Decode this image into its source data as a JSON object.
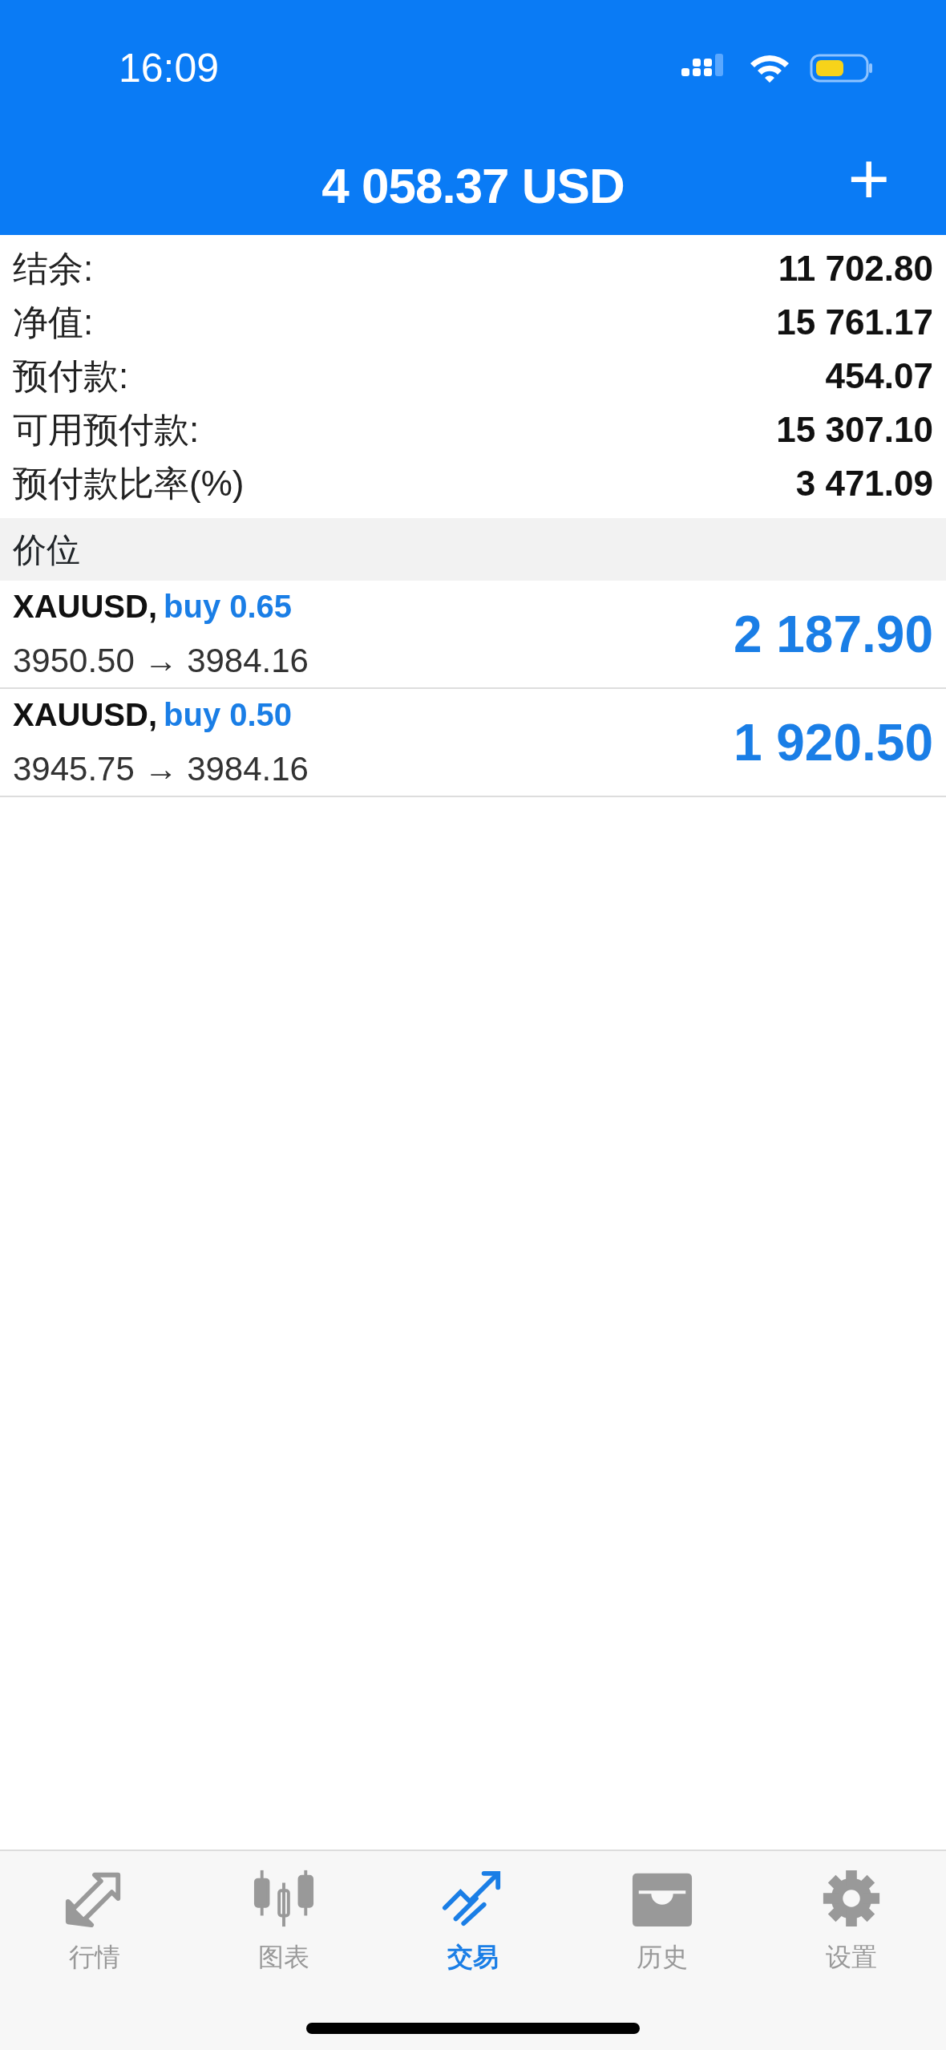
{
  "status_bar": {
    "time": "16:09"
  },
  "header": {
    "title": "4 058.37 USD",
    "add_button": "+"
  },
  "summary": [
    {
      "label": "结余:",
      "value": "11 702.80"
    },
    {
      "label": "净值:",
      "value": "15 761.17"
    },
    {
      "label": "预付款:",
      "value": "454.07"
    },
    {
      "label": "可用预付款:",
      "value": "15 307.10"
    },
    {
      "label": "预付款比率(%)",
      "value": "3 471.09"
    }
  ],
  "section": {
    "title": "价位"
  },
  "positions": [
    {
      "symbol": "XAUUSD,",
      "side": "buy 0.65",
      "prices": "3950.50 → 3984.16",
      "profit": "2 187.90"
    },
    {
      "symbol": "XAUUSD,",
      "side": "buy 0.50",
      "prices": "3945.75 → 3984.16",
      "profit": "1 920.50"
    }
  ],
  "tabs": [
    {
      "kind": "quotes",
      "label": "行情",
      "selected": false
    },
    {
      "kind": "chart",
      "label": "图表",
      "selected": false
    },
    {
      "kind": "trade",
      "label": "交易",
      "selected": true
    },
    {
      "kind": "history",
      "label": "历史",
      "selected": false
    },
    {
      "kind": "settings",
      "label": "设置",
      "selected": false
    }
  ]
}
